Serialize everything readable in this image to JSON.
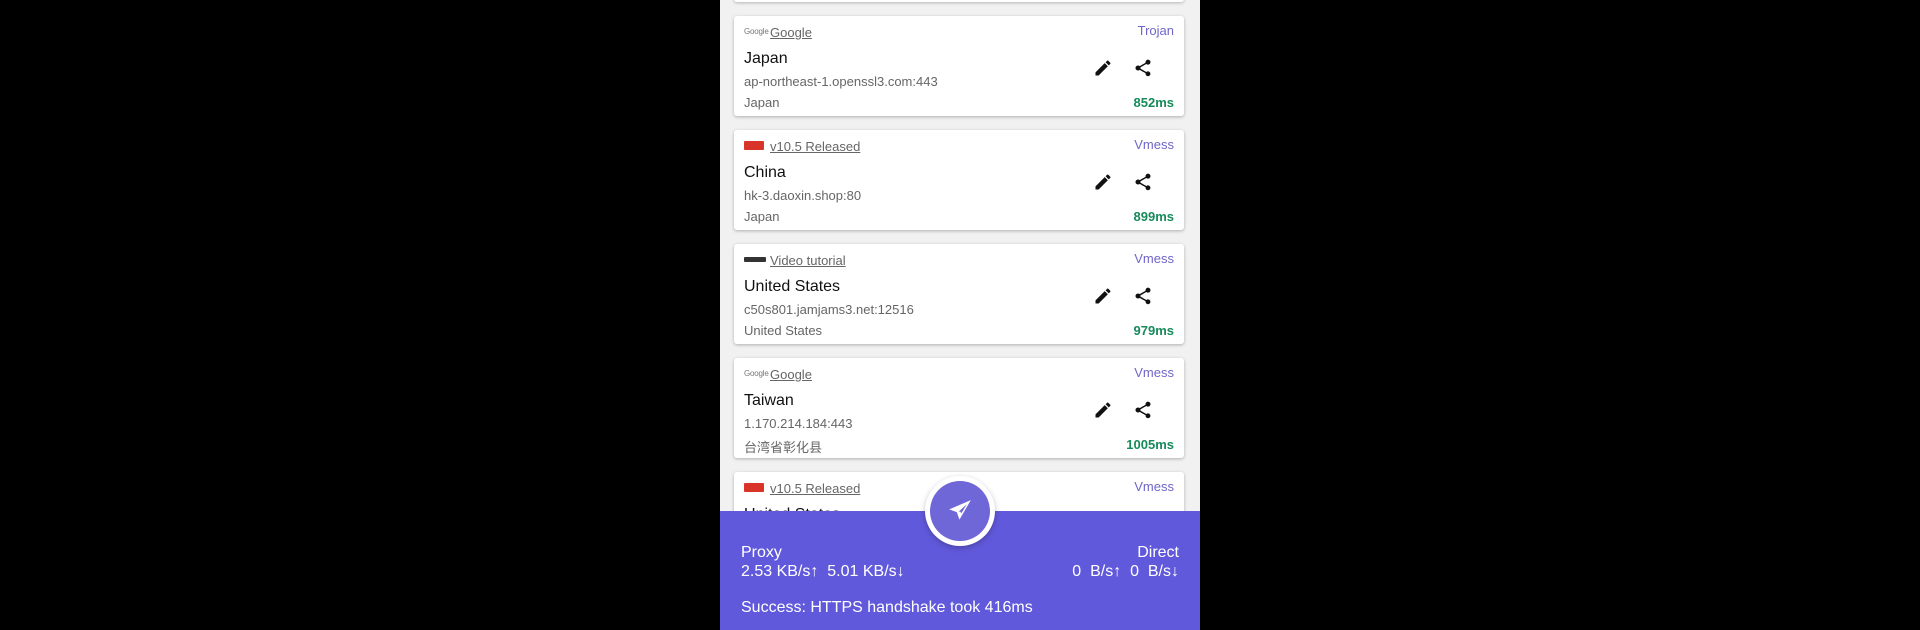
{
  "servers": [
    {
      "subscription": "Google",
      "logo": "google-logo",
      "protocol": "Trojan",
      "name": "Japan",
      "address": "ap-northeast-1.openssl3.com:443",
      "location": "Japan",
      "latency": "852ms"
    },
    {
      "subscription": "v10.5 Released",
      "logo": "red-brand-logo",
      "protocol": "Vmess",
      "name": "China",
      "address": "hk-3.daoxin.shop:80",
      "location": "Japan",
      "latency": "899ms"
    },
    {
      "subscription": "Video tutorial",
      "logo": "dark-brand-logo",
      "protocol": "Vmess",
      "name": "United States",
      "address": "c50s801.jamjams3.net:12516",
      "location": "United States",
      "latency": "979ms"
    },
    {
      "subscription": "Google",
      "logo": "google-logo",
      "protocol": "Vmess",
      "name": "Taiwan",
      "address": "1.170.214.184:443",
      "location": "台湾省彰化县",
      "latency": "1005ms"
    },
    {
      "subscription": "v10.5 Released",
      "logo": "red-brand-logo",
      "protocol": "Vmess",
      "name": "United States",
      "address": "",
      "location": "",
      "latency": ""
    }
  ],
  "logo_texts": {
    "google": "Google"
  },
  "status": {
    "proxy_label": "Proxy",
    "proxy_speed": "2.53 KB/s↑  5.01 KB/s↓",
    "direct_label": "Direct",
    "direct_speed": "0  B/s↑  0  B/s↓",
    "message": "Success: HTTPS handshake took 416ms"
  },
  "icons": {
    "edit": "pencil-icon",
    "share": "share-icon",
    "connect": "paper-plane-icon"
  },
  "colors": {
    "accent": "#6159db",
    "protocol": "#6f66c9",
    "latency": "#178a5a"
  }
}
